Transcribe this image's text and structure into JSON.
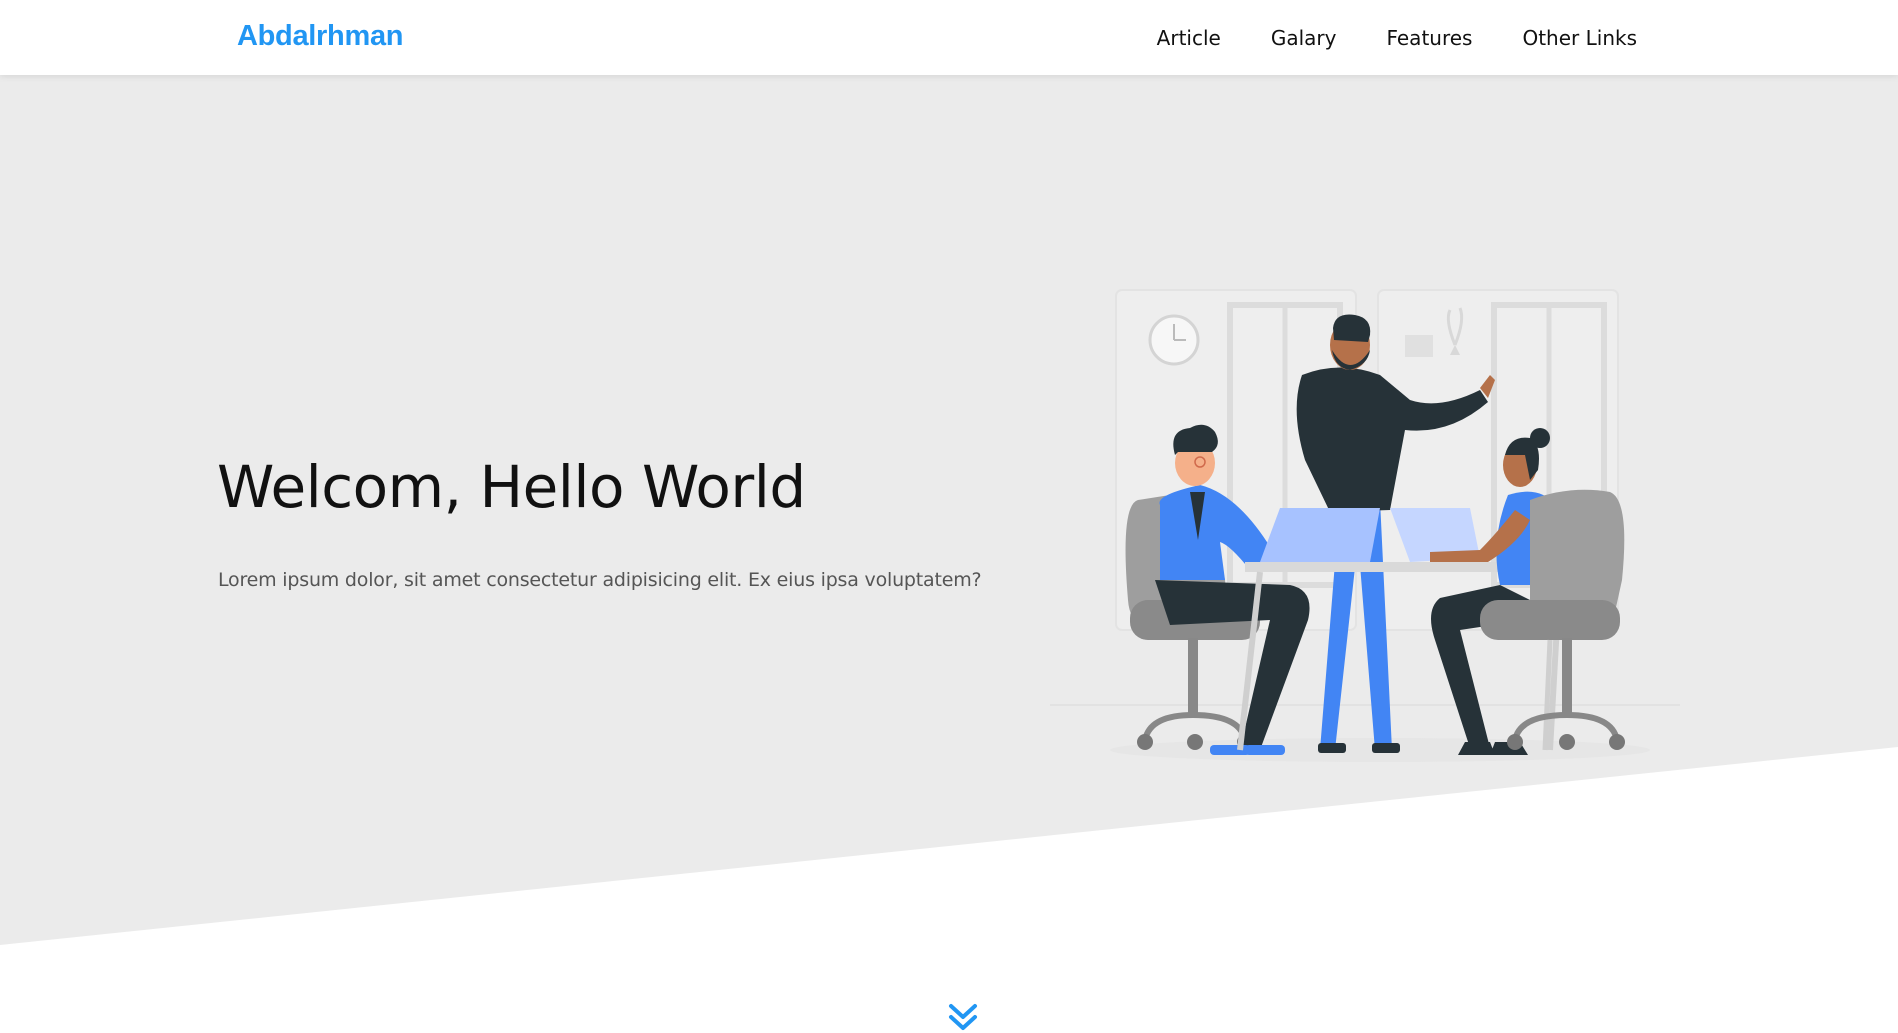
{
  "header": {
    "logo": "Abdalrhman",
    "nav": [
      {
        "label": "Article"
      },
      {
        "label": "Galary"
      },
      {
        "label": "Features"
      },
      {
        "label": "Other Links"
      }
    ]
  },
  "hero": {
    "title": "Welcom, Hello World",
    "subtitle": "Lorem ipsum dolor, sit amet consectetur adipisicing elit. Ex eius ipsa voluptatem?",
    "illustration_icon": "team-meeting-illustration",
    "scroll_icon": "double-chevron-down-icon"
  },
  "colors": {
    "accent": "#2196f3",
    "hero_background": "#ebebeb",
    "text": "#111111",
    "muted_text": "#555555"
  }
}
